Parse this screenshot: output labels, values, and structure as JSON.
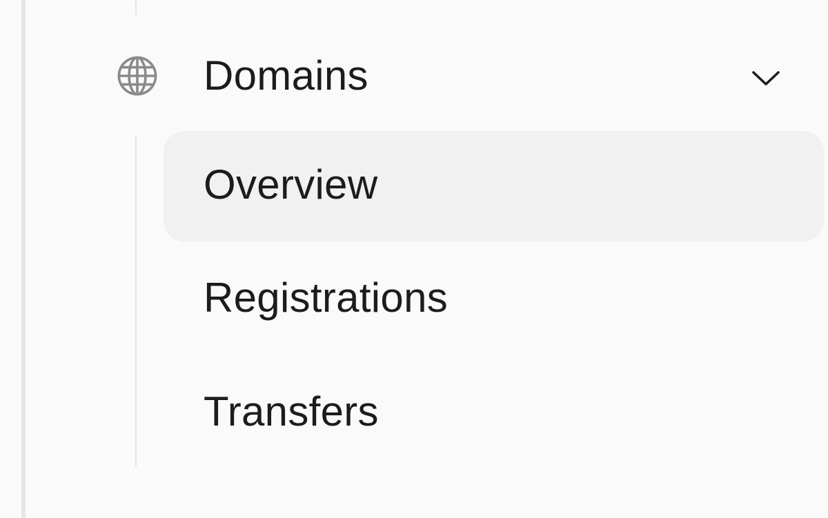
{
  "sidebar": {
    "group": {
      "label": "Domains",
      "icon": "globe-icon",
      "expanded": true,
      "toggle_icon": "chevron-down-icon"
    },
    "items": [
      {
        "label": "Overview",
        "active": true
      },
      {
        "label": "Registrations",
        "active": false
      },
      {
        "label": "Transfers",
        "active": false
      }
    ]
  },
  "colors": {
    "background": "#fafafa",
    "active_item_background": "#f1f1f1",
    "text": "#1c1c1c",
    "icon": "#8a8a8a",
    "divider": "#e4e4e4"
  }
}
